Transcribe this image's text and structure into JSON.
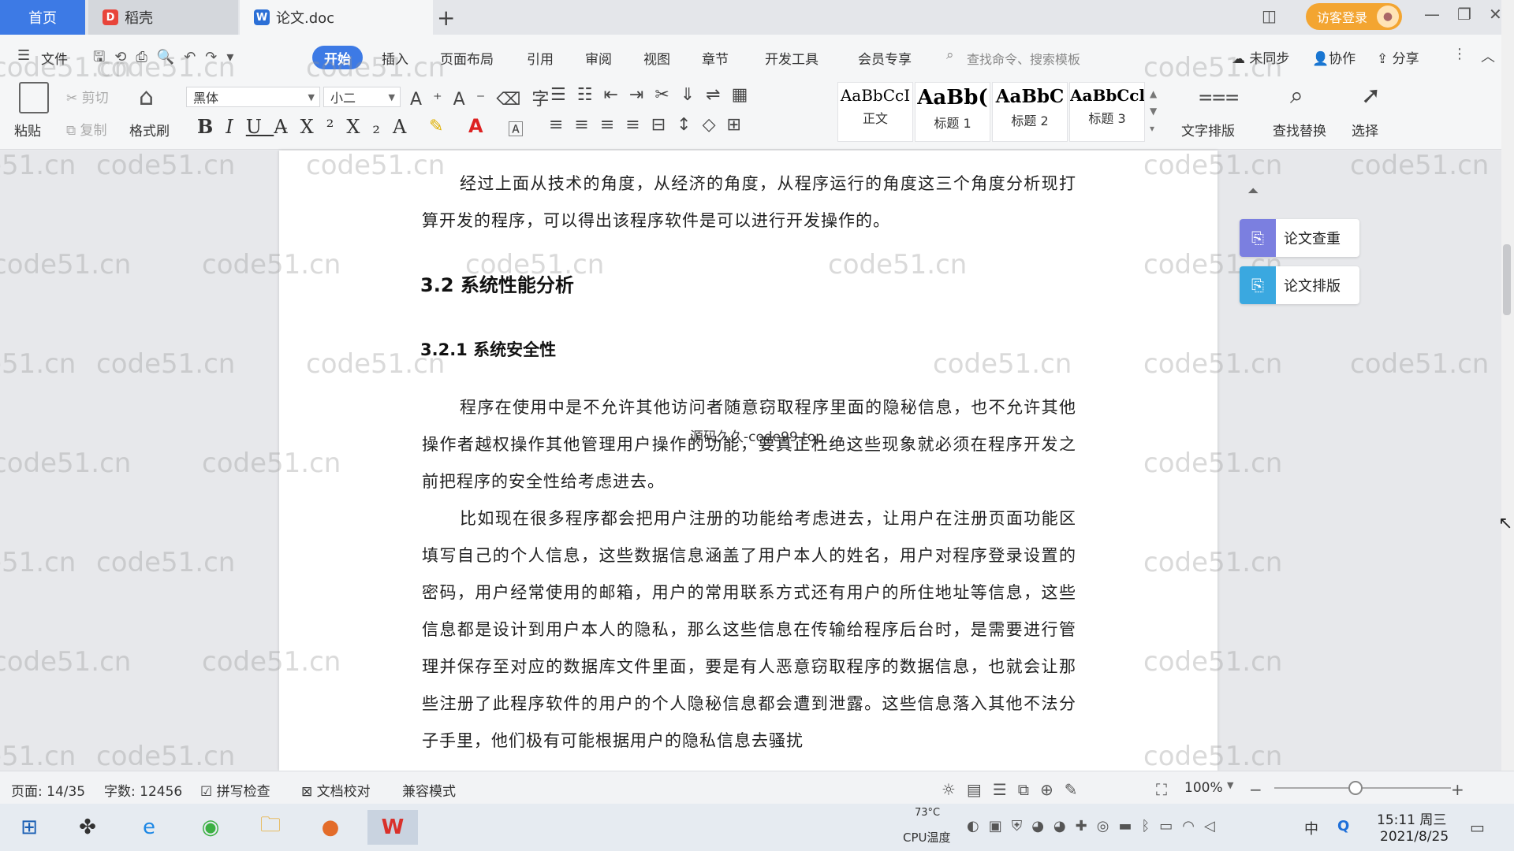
{
  "titlebar": {
    "tabs": [
      {
        "label": "首页"
      },
      {
        "label": "稻壳"
      },
      {
        "label": "论文.doc"
      }
    ],
    "login_label": "访客登录"
  },
  "menu": {
    "file": "文件",
    "items": [
      "开始",
      "插入",
      "页面布局",
      "引用",
      "审阅",
      "视图",
      "章节",
      "开发工具",
      "会员专享"
    ],
    "search_placeholder": "查找命令、搜索模板",
    "right": [
      "未同步",
      "协作",
      "分享"
    ]
  },
  "ribbon": {
    "paste": "粘贴",
    "cut": "剪切",
    "copy": "复制",
    "format_painter": "格式刷",
    "font_name": "黑体",
    "font_size": "小二",
    "styles": [
      {
        "preview": "AaBbCcI",
        "name": "正文"
      },
      {
        "preview": "AaBb(",
        "name": "标题 1"
      },
      {
        "preview": "AaBbC",
        "name": "标题 2"
      },
      {
        "preview": "AaBbCcl",
        "name": "标题 3"
      }
    ],
    "text_layout": "文字排版",
    "find_replace": "查找替换",
    "select": "选择"
  },
  "document": {
    "para_intro": "经过上面从技术的角度，从经济的角度，从程序运行的角度这三个角度分析现打算开发的程序，可以得出该程序软件是可以进行开发操作的。",
    "heading_2": "3.2 系统性能分析",
    "heading_3": "3.2.1  系统安全性",
    "para_1": "程序在使用中是不允许其他访问者随意窃取程序里面的隐秘信息，也不允许其他操作者越权操作其他管理用户操作的功能，要真正杜绝这些现象就必须在程序开发之前把程序的安全性给考虑进去。",
    "para_2": "比如现在很多程序都会把用户注册的功能给考虑进去，让用户在注册页面功能区填写自己的个人信息，这些数据信息涵盖了用户本人的姓名，用户对程序登录设置的密码，用户经常使用的邮箱，用户的常用联系方式还有用户的所住地址等信息，这些信息都是设计到用户本人的隐私，那么这些信息在传输给程序后台时，是需要进行管理并保存至对应的数据库文件里面，要是有人恶意窃取程序的数据信息，也就会让那些注册了此程序软件的用户的个人隐秘信息都会遭到泄露。这些信息落入其他不法分子手里，他们极有可能根据用户的隐私信息去骚扰",
    "overlay_text": "源码久久-code99.top",
    "watermark": "code51.cn"
  },
  "side_panel": {
    "check": "论文查重",
    "format": "论文排版"
  },
  "statusbar": {
    "page": "页面: 14/35",
    "words": "字数: 12456",
    "spell": "拼写检查",
    "proof": "文档校对",
    "compat": "兼容模式",
    "zoom": "100%"
  },
  "taskbar": {
    "temp": "73°C",
    "cpu_label": "CPU温度",
    "ime": "中",
    "time": "15:11 周三",
    "date": "2021/8/25"
  },
  "colors": {
    "accent": "#3d7ae5",
    "login": "#f3a531"
  }
}
